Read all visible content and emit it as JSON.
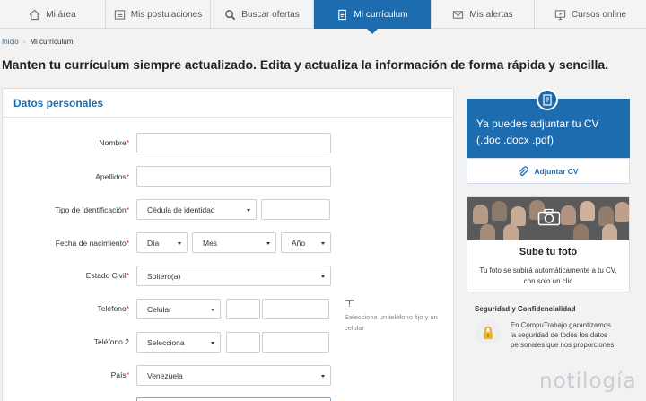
{
  "nav": {
    "items": [
      {
        "label": "Mi área",
        "icon": "home-icon"
      },
      {
        "label": "Mis postulaciones",
        "icon": "list-icon"
      },
      {
        "label": "Buscar ofertas",
        "icon": "search-icon"
      },
      {
        "label": "Mi currículum",
        "icon": "document-icon",
        "active": true
      },
      {
        "label": "Mis alertas",
        "icon": "envelope-icon"
      },
      {
        "label": "Cursos online",
        "icon": "monitor-icon"
      }
    ]
  },
  "breadcrumb": {
    "home": "Inicio",
    "current": "Mi currículum"
  },
  "headline": "Manten tu currículum siempre actualizado. Edita y actualiza la información de forma rápida y sencilla.",
  "form": {
    "title": "Datos personales",
    "required_mark": "*",
    "labels": {
      "nombre": "Nombre",
      "apellidos": "Apellidos",
      "tipo_id": "Tipo de identificación",
      "fecha": "Fecha de nacimiento",
      "estado_civil": "Estado Civil",
      "telefono": "Teléfono",
      "telefono2": "Teléfono 2",
      "pais": "País"
    },
    "values": {
      "tipo_id": "Cédula de identidad",
      "dia": "Día",
      "mes": "Mes",
      "anio": "Año",
      "estado_civil": "Soltero(a)",
      "telefono_tipo": "Celular",
      "telefono2_tipo": "Selecciona",
      "pais": "Venezuela"
    },
    "hint_icon": "!",
    "phone_hint": "Selecciona un teléfono fijo y un celular"
  },
  "cv_upload": {
    "text": "Ya puedes adjuntar tu CV (.doc .docx .pdf)",
    "button": "Adjuntar CV",
    "icon": "cv-document-icon",
    "button_icon": "paperclip-icon"
  },
  "photo": {
    "title": "Sube tu foto",
    "subtitle": "Tu foto se subirá automáticamente a tu CV, con solo un clic",
    "icon": "camera-icon"
  },
  "security": {
    "title": "Seguridad y Confidencialidad",
    "text": "En CompuTrabajo garantizamos la seguridad de todos los datos personales que nos proporciones.",
    "icon": "lock-icon"
  },
  "watermark": "notilogía",
  "colors": {
    "primary": "#1e6cb0",
    "required": "#d0312d",
    "background": "#f2f2f2"
  }
}
